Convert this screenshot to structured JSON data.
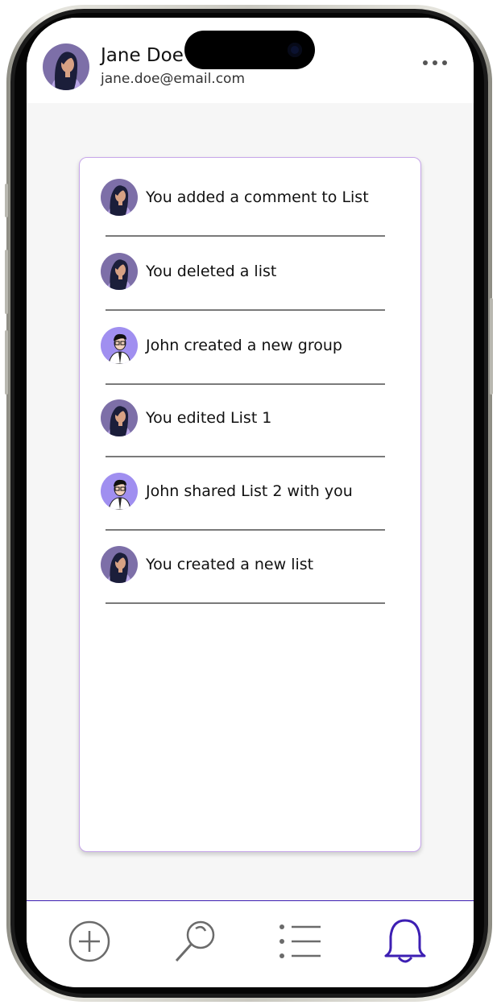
{
  "user": {
    "name": "Jane Doe",
    "email": "jane.doe@email.com"
  },
  "header": {
    "more_icon": "more-horizontal-icon"
  },
  "activity": {
    "items": [
      {
        "text": "You added a comment to List",
        "avatar": "jane-avatar"
      },
      {
        "text": "You deleted a list",
        "avatar": "jane-avatar"
      },
      {
        "text": "John created a new group",
        "avatar": "john-avatar"
      },
      {
        "text": "You edited List 1",
        "avatar": "jane-avatar"
      },
      {
        "text": "John shared List 2 with you",
        "avatar": "john-avatar"
      },
      {
        "text": "You created a new list",
        "avatar": "jane-avatar"
      }
    ]
  },
  "nav": {
    "items": [
      {
        "icon": "plus-circle-icon",
        "active": false
      },
      {
        "icon": "search-icon",
        "active": false
      },
      {
        "icon": "list-icon",
        "active": false
      },
      {
        "icon": "bell-icon",
        "active": true
      }
    ]
  },
  "colors": {
    "accent": "#3d1fb3",
    "card_border": "#c7a6ea",
    "jane_avatar_bg": "#7d6fa8",
    "john_avatar_bg": "#a08ff0",
    "icon_inactive": "#6b6b6b"
  }
}
